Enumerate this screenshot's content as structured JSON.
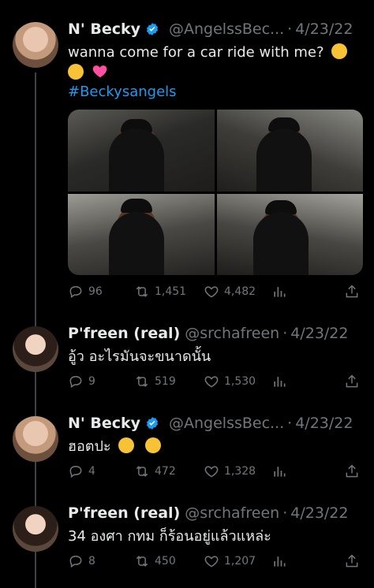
{
  "tweets": [
    {
      "name": "N' Becky",
      "verified": true,
      "handle": "@AngelssBec...",
      "dot": "·",
      "date": "4/23/22",
      "text": "wanna come for a car ride with me?",
      "hashtag": "#Beckysangels",
      "emojis": [
        "yum-emoji",
        "kiss-emoji",
        "heart-emoji"
      ],
      "stats": {
        "replies": "96",
        "retweets": "1,451",
        "likes": "4,482"
      }
    },
    {
      "name": "P'freen (real)",
      "verified": false,
      "handle": "@srchafreen",
      "dot": "·",
      "date": "4/23/22",
      "text": "อู้ว อะไรมันจะขนาดนั้น",
      "stats": {
        "replies": "9",
        "retweets": "519",
        "likes": "1,530"
      }
    },
    {
      "name": "N' Becky",
      "verified": true,
      "handle": "@AngelssBec...",
      "dot": "·",
      "date": "4/23/22",
      "text": "ฮอตปะ",
      "emojis": [
        "flushed-emoji",
        "relieved-emoji"
      ],
      "stats": {
        "replies": "4",
        "retweets": "472",
        "likes": "1,328"
      }
    },
    {
      "name": "P'freen (real)",
      "verified": false,
      "handle": "@srchafreen",
      "dot": "·",
      "date": "4/23/22",
      "text": "34 องศา กทม ก็ร้อนอยู่แล้วแหล่ะ",
      "stats": {
        "replies": "8",
        "retweets": "450",
        "likes": "1,207"
      }
    }
  ],
  "colors": {
    "background": "#000000",
    "text": "#e7e9ea",
    "muted": "#71767b",
    "link": "#1d9bf0",
    "verified": "#1d9bf0"
  },
  "icons": [
    "reply-icon",
    "retweet-icon",
    "like-icon",
    "views-icon",
    "share-icon",
    "verified-badge-icon"
  ]
}
